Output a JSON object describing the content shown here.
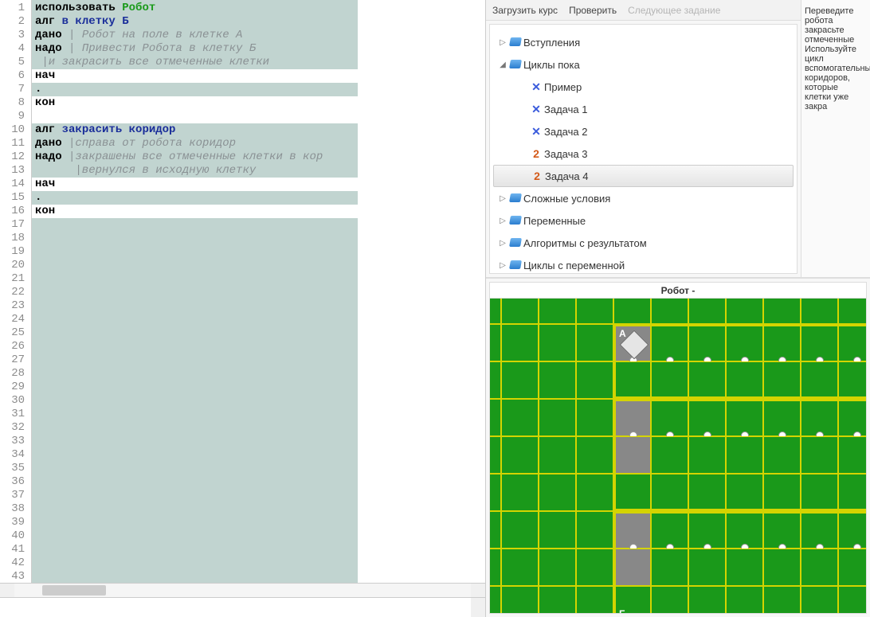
{
  "editor": {
    "lines": 43,
    "code": {
      "l1_use": "использовать",
      "l1_robot": "Робот",
      "l2_alg": "алг",
      "l2_name": "в клетку Б",
      "l3_dano": "дано",
      "l3_c": " | Робот на поле в клетке А",
      "l4_nado": "надо",
      "l4_c": " | Привести Робота в клетку Б",
      "l5_c": " |и закрасить все отмеченные клетки",
      "l6_nach": "нач",
      "l7_dot": ".",
      "l8_kon": "кон",
      "l10_alg": "алг",
      "l10_name": "закрасить коридор",
      "l11_dano": "дано",
      "l11_c": " |справа от робота коридор",
      "l12_nado": "надо",
      "l12_c": " |закрашены все отмеченные клетки в кор",
      "l13_c": "      |вернулся в исходную клетку",
      "l14_nach": "нач",
      "l15_dot": ".",
      "l16_kon": "кон"
    }
  },
  "toolbar": {
    "load": "Загрузить курс",
    "check": "Проверить",
    "next": "Следующее задание"
  },
  "tree": {
    "intro": "Вступления",
    "loops": "Циклы пока",
    "example": "Пример",
    "task1": "Задача 1",
    "task2": "Задача 2",
    "task3": "Задача 3",
    "task4": "Задача 4",
    "complex": "Сложные условия",
    "vars": "Переменные",
    "algres": "Алгоритмы с результатом",
    "cycvar": "Циклы с переменной"
  },
  "info": "Переведите робота закрасьте отмеченные Используйте цикл вспомогательный коридоров, которые клетки уже закра",
  "robot": {
    "title": "Робот -",
    "labelA": "А",
    "labelB": "Б"
  }
}
